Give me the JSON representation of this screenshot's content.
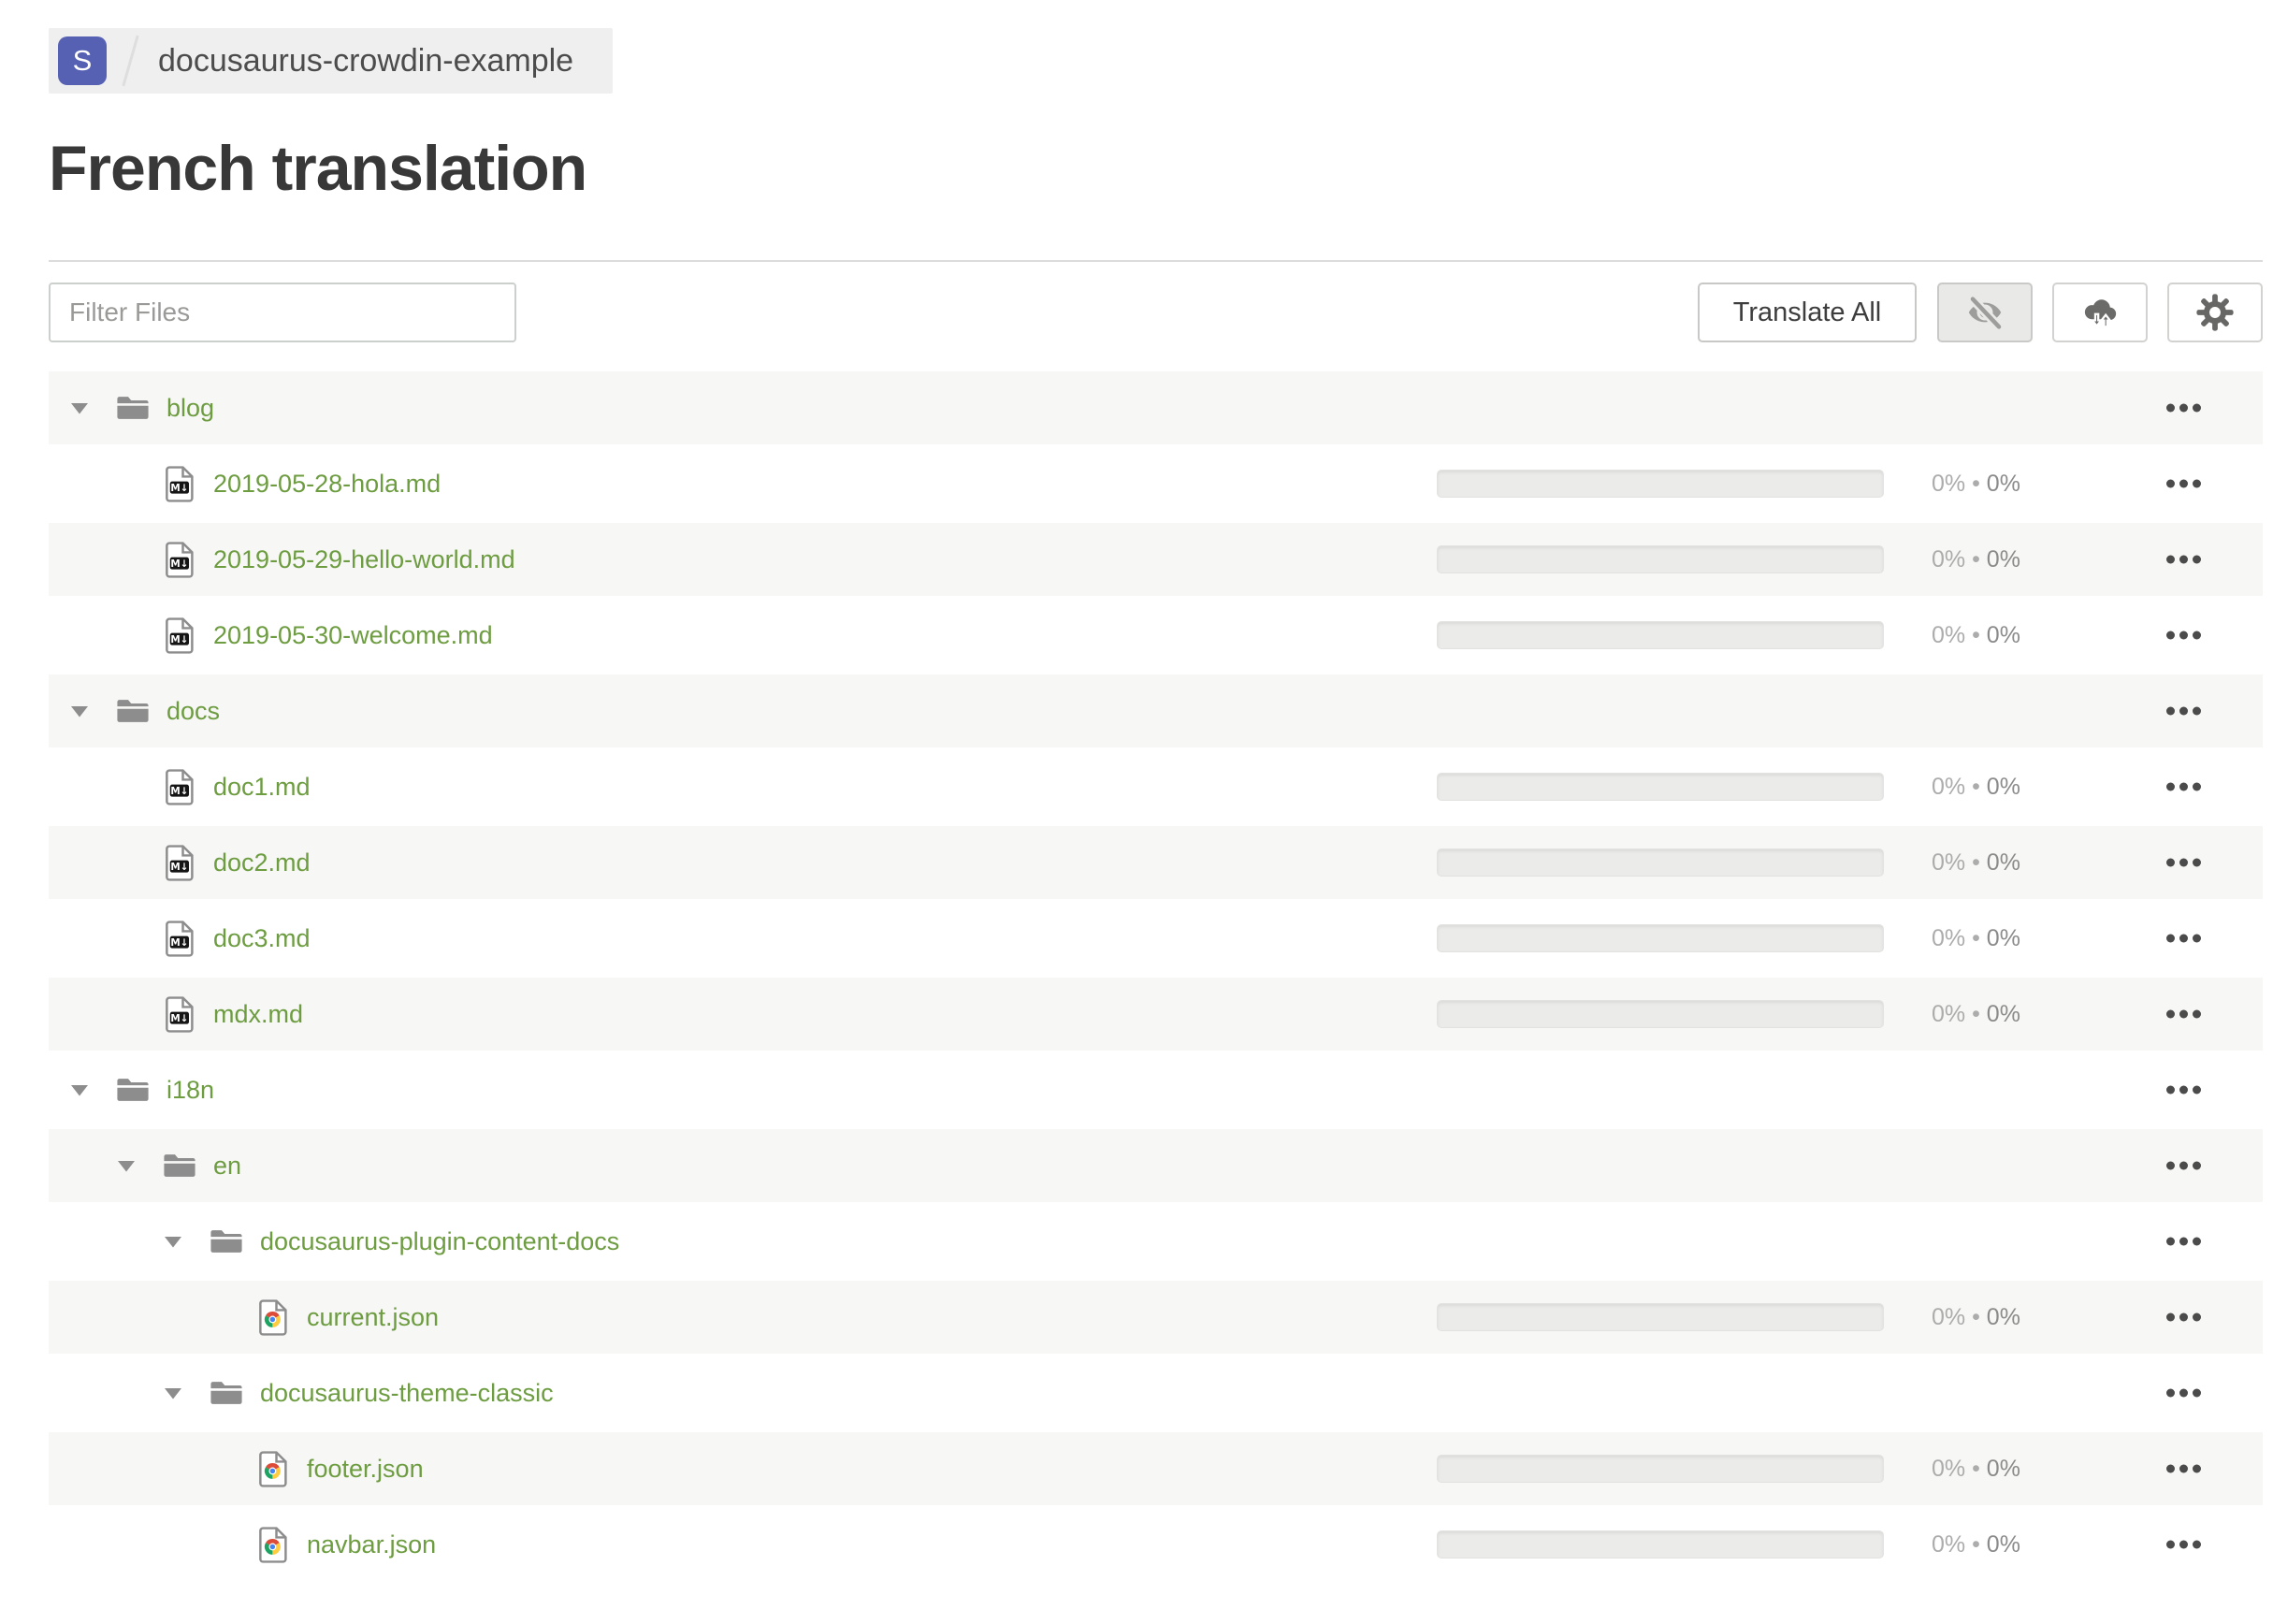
{
  "breadcrumb": {
    "badge": "S",
    "project_name": "docusaurus-crowdin-example"
  },
  "page_title": "French translation",
  "toolbar": {
    "filter_placeholder": "Filter Files",
    "translate_all_label": "Translate All",
    "icon_buttons": [
      {
        "name": "hide-completed-button",
        "icon": "eye-off-icon",
        "active": true
      },
      {
        "name": "download-upload-button",
        "icon": "cloud-download-upload-icon",
        "active": false
      },
      {
        "name": "settings-button",
        "icon": "gear-icon",
        "active": false
      }
    ]
  },
  "colors": {
    "accent_green": "#6d9c41",
    "badge_indigo": "#5661b4",
    "row_alt_bg": "#f7f7f5",
    "icon_gray": "#8d8d8d",
    "progress_track": "#ebebe9",
    "percent_translated_color": "#acacac",
    "percent_approved_color": "#8b8b8b"
  },
  "file_tree": {
    "percent_separator": "•",
    "rows": [
      {
        "type": "folder",
        "depth": 0,
        "name": "blog"
      },
      {
        "type": "file",
        "file_kind": "markdown",
        "depth": 1,
        "name": "2019-05-28-hola.md",
        "translated": "0%",
        "approved": "0%"
      },
      {
        "type": "file",
        "file_kind": "markdown",
        "depth": 1,
        "name": "2019-05-29-hello-world.md",
        "translated": "0%",
        "approved": "0%"
      },
      {
        "type": "file",
        "file_kind": "markdown",
        "depth": 1,
        "name": "2019-05-30-welcome.md",
        "translated": "0%",
        "approved": "0%"
      },
      {
        "type": "folder",
        "depth": 0,
        "name": "docs"
      },
      {
        "type": "file",
        "file_kind": "markdown",
        "depth": 1,
        "name": "doc1.md",
        "translated": "0%",
        "approved": "0%"
      },
      {
        "type": "file",
        "file_kind": "markdown",
        "depth": 1,
        "name": "doc2.md",
        "translated": "0%",
        "approved": "0%"
      },
      {
        "type": "file",
        "file_kind": "markdown",
        "depth": 1,
        "name": "doc3.md",
        "translated": "0%",
        "approved": "0%"
      },
      {
        "type": "file",
        "file_kind": "markdown",
        "depth": 1,
        "name": "mdx.md",
        "translated": "0%",
        "approved": "0%"
      },
      {
        "type": "folder",
        "depth": 0,
        "name": "i18n"
      },
      {
        "type": "folder",
        "depth": 1,
        "name": "en"
      },
      {
        "type": "folder",
        "depth": 2,
        "name": "docusaurus-plugin-content-docs"
      },
      {
        "type": "file",
        "file_kind": "json",
        "depth": 3,
        "name": "current.json",
        "translated": "0%",
        "approved": "0%"
      },
      {
        "type": "folder",
        "depth": 2,
        "name": "docusaurus-theme-classic"
      },
      {
        "type": "file",
        "file_kind": "json",
        "depth": 3,
        "name": "footer.json",
        "translated": "0%",
        "approved": "0%"
      },
      {
        "type": "file",
        "file_kind": "json",
        "depth": 3,
        "name": "navbar.json",
        "translated": "0%",
        "approved": "0%"
      }
    ]
  }
}
